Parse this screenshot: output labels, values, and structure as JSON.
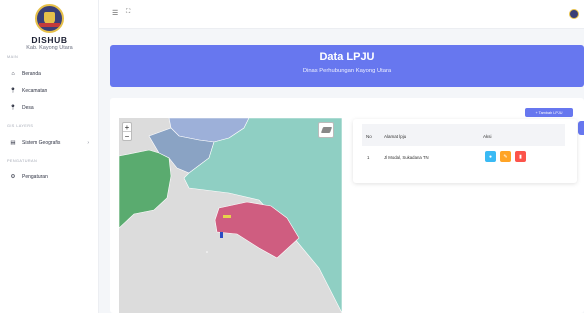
{
  "brand": {
    "name": "DISHUB",
    "subtitle": "Kab. Kayong Utara"
  },
  "sidebar": {
    "sections": [
      {
        "label": "MAIN"
      },
      {
        "label": "GIS LAYERS"
      },
      {
        "label": "PENGATURAN"
      }
    ],
    "items": [
      {
        "label": "Beranda",
        "icon": "home-icon"
      },
      {
        "label": "Kecamatan",
        "icon": "pin-icon"
      },
      {
        "label": "Desa",
        "icon": "pin-icon"
      },
      {
        "label": "Sistem Geografis",
        "icon": "map-icon"
      },
      {
        "label": "Pengaturan",
        "icon": "gears-icon"
      }
    ]
  },
  "header": {
    "title": "Data LPJU",
    "subtitle": "Dinas Perhubungan Kayong Utara"
  },
  "toolbar": {
    "add_label": "+ Tambah LPJU"
  },
  "map": {
    "zoom_in": "+",
    "zoom_out": "−"
  },
  "table": {
    "columns": [
      "No",
      "Alamat lpju",
      "Aksi"
    ],
    "rows": [
      {
        "no": "1",
        "alamat": "Jl Modal, Sukadana TN"
      }
    ]
  },
  "colors": {
    "accent": "#6777ef",
    "btn_view": "#3abaf4",
    "btn_edit": "#ffa426",
    "btn_delete": "#fc544b",
    "region_teal": "#8fcfc3",
    "region_green": "#5aab6f",
    "region_rose": "#cf5d80",
    "region_slate": "#8aa3c4",
    "region_blue": "#9db0d9"
  }
}
